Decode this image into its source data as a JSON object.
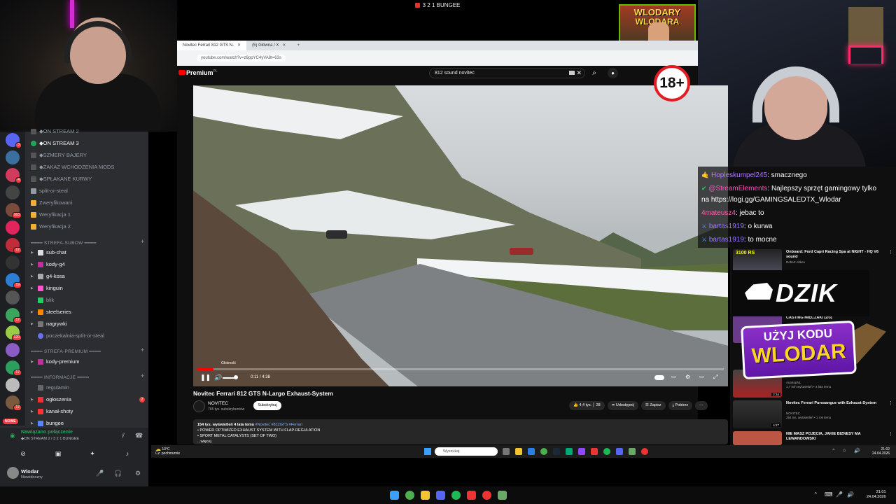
{
  "stream": {
    "rec_title": "3 2 1 BUNGEE",
    "banner_line1": "WLODARY",
    "banner_line2": "WLODARA",
    "age_badge": "18+"
  },
  "browser": {
    "tabs": [
      {
        "label": "Novitec Ferrari 812 GTS N-",
        "close": "✕"
      },
      {
        "label": "(5) Główna / X",
        "close": "✕"
      }
    ],
    "new_tab": "+",
    "url": "youtube.com/watch?v=z6ppYC4yVA8t=63s"
  },
  "youtube": {
    "logo": "Premium",
    "logo_region": "PL",
    "search_value": "812 sound novitec",
    "search_clear": "✕",
    "search_button_icon": "search-icon",
    "mic_icon": "mic-icon",
    "player": {
      "volume_tooltip": "Głośność",
      "time": "0:11 / 4:38",
      "progress_percent": 3
    },
    "video_title": "Novitec Ferrari 812 GTS N-Largo Exhaust-System",
    "channel": {
      "name": "NOVITEC",
      "subscribers": "765 tys. subskrybentów",
      "subscribe_label": "Subskrybuj"
    },
    "actions": {
      "likes": "4,4 tys.",
      "dislikes": "28",
      "share": "Udostępnij",
      "save": "Zapisz",
      "download": "Pobierz",
      "more": "⋯"
    },
    "description": {
      "stats": "154 tys. wyświetleń  4 lata temu",
      "tags": "#Novitec #812GTS #Ferrari",
      "line1": "• POWER OPTIMIZED EXHAUST SYSTEM WITH FLAP-REGULATION",
      "line2": "• SPORT METAL CATALYSTS (SET OF TWO)",
      "more": "...więcej"
    }
  },
  "discord": {
    "channels_top": [
      {
        "label": "◆ON STREAM 2"
      },
      {
        "label": "◆ON STREAM 3"
      },
      {
        "label": "◆SZMERY BAJERY"
      },
      {
        "label": "◆ZAKAZ WCHODZENIA MODS"
      },
      {
        "label": "◆SPŁAKANE KURWY"
      },
      {
        "label": "split-or-steal"
      },
      {
        "label": "Zweryfikowani"
      },
      {
        "label": "Weryfikacja 1"
      },
      {
        "label": "Weryfikacja 2"
      }
    ],
    "cat_subow": "STREFA-SUBOW",
    "channels_subow": [
      {
        "label": "sub-chat"
      },
      {
        "label": "kody-g4"
      },
      {
        "label": "g4-kosa"
      },
      {
        "label": "kinguin"
      },
      {
        "label": "blik"
      },
      {
        "label": "steelseries"
      },
      {
        "label": "nagrywki"
      },
      {
        "label": "poczekalnia-split-or-steal"
      }
    ],
    "cat_premium": "STREFA-PREMIUM",
    "channels_premium": [
      {
        "label": "kody-premium"
      }
    ],
    "cat_info": "INFORMACJE",
    "channels_info": [
      {
        "label": "regulamin"
      },
      {
        "label": "ogłoszenia"
      },
      {
        "label": "kanał-shoty"
      },
      {
        "label": "bungee"
      }
    ],
    "server_badges": [
      "3",
      "4",
      "163",
      "17",
      "19",
      "17",
      "120",
      "17",
      "17"
    ],
    "mention_count": "2",
    "nowe": "NOWE",
    "voice": {
      "status": "Nawiązano połączenie",
      "channel": "◆ON STREAM 2 / 3 2 1 BUNGEE"
    },
    "user": {
      "name": "Wlodar",
      "status": "Niewidoczny"
    }
  },
  "chat": {
    "messages": [
      {
        "user": "Hopleskumpel245",
        "text": ": smacznego"
      },
      {
        "user": "@StreamElements",
        "text": ": Najlepszy sprzęt gamingowy tylko"
      },
      {
        "user": "",
        "text": "na https://logi.gg/GAMINGSALEDTX_Wlodar"
      },
      {
        "user": "4mateusz4",
        "text": ": jebac to"
      },
      {
        "user": "bartas1919",
        "text": ": o kurwa"
      },
      {
        "user": "bartas1919",
        "text": ": to mocne"
      }
    ]
  },
  "sidebar": {
    "items": [
      {
        "title": "Onboard: Ford Capri Racing Spa at NIGHT - HQ V6 sound",
        "meta": "Robert Altken",
        "thumb_text": "3100 RS",
        "duration": ""
      },
      {
        "title": "CASTING MIĘCZAKI (2/3)",
        "meta": "",
        "thumb_text": "",
        "duration": ""
      },
      {
        "title": "333km/h & INSANE F1 V12 ...",
        "meta": "AutotopNL\n1,7 mln wyświetleń • 3 lata temu",
        "thumb_text": "",
        "duration": "2:34"
      },
      {
        "title": "Novitec Ferrari Purosangue with Exhaust-System",
        "meta": "NOVITEC\n254 tys. wyświetleń • 1 rok temu",
        "thumb_text": "",
        "duration": "4:27"
      },
      {
        "title": "NIE MASZ POJĘCIA, JAKIE BIZNESY MA LEWANDOWSKI",
        "meta": "",
        "thumb_text": "",
        "duration": ""
      }
    ],
    "dzik": "DZIK",
    "promo_line1": "UŻYJ KODU",
    "promo_line2": "WLODAR"
  },
  "inner_taskbar": {
    "temp": "13°C",
    "weather": "Cz. pochmurnie",
    "search_placeholder": "Wyszukaj",
    "time": "21:02",
    "date": "24.04.2026"
  },
  "taskbar": {
    "time": "21:01",
    "date": "24.04.2026"
  }
}
